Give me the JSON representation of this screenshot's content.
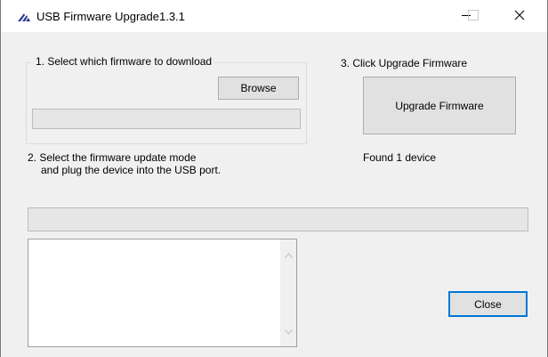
{
  "window": {
    "title": "USB Firmware Upgrade1.3.1",
    "icon": "app-logo-icon",
    "controls": {
      "minimize": "minimize-icon",
      "maximize": "maximize-icon",
      "close": "close-icon"
    }
  },
  "step1": {
    "legend": "1. Select which firmware to download",
    "browse_label": "Browse",
    "file_path_value": ""
  },
  "step2": {
    "line1": "2. Select the firmware update mode",
    "line2": "and plug the device into the USB port."
  },
  "step3": {
    "title": "3. Click Upgrade Firmware",
    "upgrade_label": "Upgrade Firmware",
    "status": "Found 1 device"
  },
  "progress": {
    "value": 0
  },
  "log": {
    "text": ""
  },
  "close_label": "Close"
}
